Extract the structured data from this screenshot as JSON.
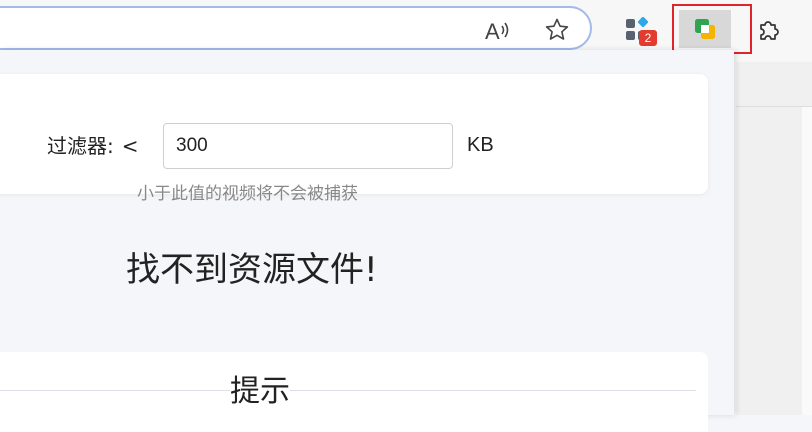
{
  "toolbar": {
    "icons": [
      "read-aloud-icon",
      "star-icon",
      "extensions-apps-icon",
      "video-downloader-extension-icon",
      "puzzle-icon"
    ],
    "apps_badge_count": "2",
    "accent_color": "#e0242b"
  },
  "filter": {
    "label": "过滤器:",
    "less_than": "<",
    "value": "300",
    "unit": "KB",
    "hint": "小于此值的视频将不会被捕获"
  },
  "main": {
    "empty_message": "找不到资源文件!"
  },
  "tips": {
    "title": "提示"
  }
}
